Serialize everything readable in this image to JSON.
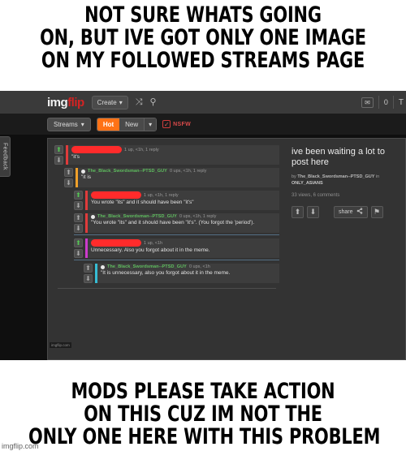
{
  "meme": {
    "top_caption": [
      "NOT SURE WHATS GOING",
      "ON, BUT IVE GOT ONLY ONE IMAGE",
      "ON MY FOLLOWED STREAMS PAGE"
    ],
    "bottom_caption": [
      "MODS PLEASE TAKE ACTION",
      "ON THIS CUZ IM NOT THE",
      "ONLY ONE HERE WITH THIS PROBLEM"
    ],
    "watermark": "imgflip.com"
  },
  "screenshot": {
    "inner_watermark": "imgflip.com",
    "feedback_tab": "Feedback",
    "topbar": {
      "logo_img": "img",
      "logo_flip": "flip",
      "create_label": "Create",
      "create_caret": "▾",
      "shuffle_icon": "⤨",
      "search_icon": "⚲",
      "mail_icon": "✉",
      "notification_count": "0",
      "profile_initial": "T"
    },
    "navrow": {
      "streams_label": "Streams",
      "streams_caret": "▾",
      "hot_label": "Hot",
      "new_label": "New",
      "sort_caret": "▾",
      "nsfw_label": "NSFW",
      "nsfw_check": "✓"
    },
    "post": {
      "title": "ive been waiting a lot to post here",
      "by_prefix": "by",
      "author": "The_Black_Swordsman--PTSD_GUY",
      "in_word": "in",
      "stream": "ONLY_ASIANS",
      "stats": "33 views, 6 comments",
      "upvote_icon": "⬆",
      "downvote_icon": "⬇",
      "share_label": "share",
      "share_icon": "☰",
      "flag_icon": "⚑"
    },
    "comments": [
      {
        "indent": "",
        "accent": "b-red",
        "username": null,
        "redacted": true,
        "meta": "1 up, <1h, 1 reply",
        "upvoted": true,
        "text": "\"it's"
      },
      {
        "indent": "indent1",
        "accent": "b-orange",
        "username": "The_Black_Swordsman--PTSD_GUY",
        "redacted": false,
        "meta": "0 ups, <1h, 1 reply",
        "upvoted": false,
        "text": "\"it is"
      },
      {
        "indent": "indent2",
        "accent": "b-red",
        "username": null,
        "redacted": true,
        "meta": "1 up, <1h, 1 reply",
        "upvoted": true,
        "text": "You wrote \"its\" and it should have been \"it's\""
      },
      {
        "indent": "indent2",
        "accent": "b-red",
        "username": "The_Black_Swordsman--PTSD_GUY",
        "redacted": false,
        "meta": "0 ups, <1h, 1 reply",
        "upvoted": false,
        "text": "\"You wrote \"its\" and it should have been \"it's\". (You forgot the 'period')."
      },
      {
        "indent": "indent2",
        "accent": "b-magenta",
        "username": null,
        "redacted": true,
        "meta": "1 up, <1h",
        "upvoted": true,
        "text": "Unnecessary. Also you forgot about it in the meme."
      },
      {
        "indent": "indent3",
        "accent": "b-cyan",
        "username": "The_Black_Swordsman--PTSD_GUY",
        "redacted": false,
        "meta": "0 ups, <1h",
        "upvoted": false,
        "text": "\"It is unnecessary, also you forgot about it in the meme."
      }
    ]
  },
  "colors": {
    "accent_orange": "#ff7216",
    "logo_red": "#d32323",
    "username_green": "#5fbf5f",
    "redaction_red": "#ff2b2b",
    "upvote_green": "#55c455",
    "panel_bg": "#333333",
    "page_bg": "#0f0f0f"
  }
}
